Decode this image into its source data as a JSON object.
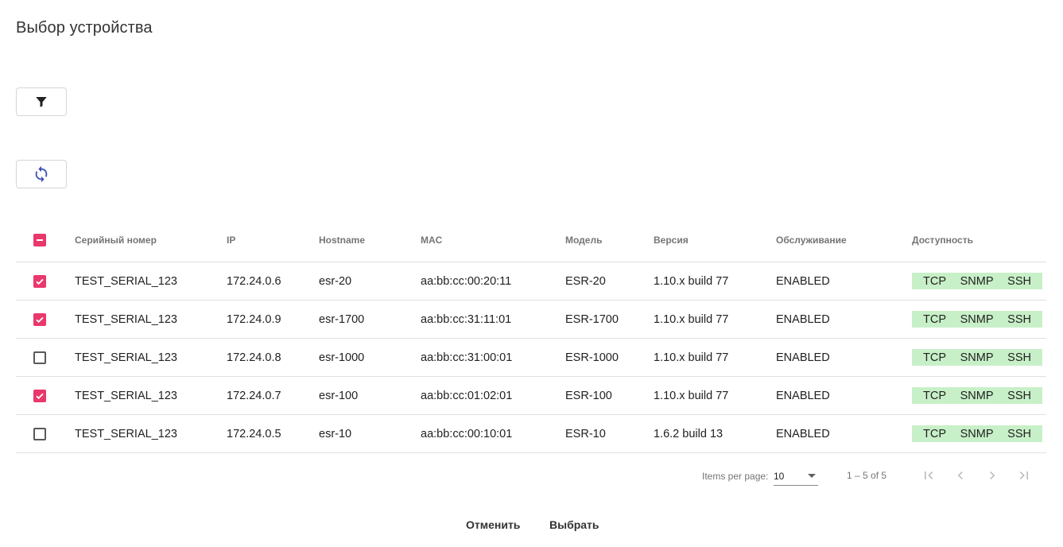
{
  "dialog": {
    "title": "Выбор устройства",
    "cancel_label": "Отменить",
    "select_label": "Выбрать"
  },
  "toolbar": {
    "filter_icon": "filter-icon",
    "refresh_icon": "refresh-icon"
  },
  "table": {
    "headers": {
      "serial": "Серийный номер",
      "ip": "IP",
      "hostname": "Hostname",
      "mac": "MAC",
      "model": "Модель",
      "version": "Версия",
      "service": "Обслуживание",
      "availability": "Доступность"
    },
    "header_checkbox_state": "indeterminate",
    "rows": [
      {
        "checked": true,
        "serial": "TEST_SERIAL_123",
        "ip": "172.24.0.6",
        "hostname": "esr-20",
        "mac": "aa:bb:cc:00:20:11",
        "model": "ESR-20",
        "version": "1.10.x build 77",
        "service": "ENABLED",
        "availability": [
          "TCP",
          "SNMP",
          "SSH"
        ]
      },
      {
        "checked": true,
        "serial": "TEST_SERIAL_123",
        "ip": "172.24.0.9",
        "hostname": "esr-1700",
        "mac": "aa:bb:cc:31:11:01",
        "model": "ESR-1700",
        "version": "1.10.x build 77",
        "service": "ENABLED",
        "availability": [
          "TCP",
          "SNMP",
          "SSH"
        ]
      },
      {
        "checked": false,
        "serial": "TEST_SERIAL_123",
        "ip": "172.24.0.8",
        "hostname": "esr-1000",
        "mac": "aa:bb:cc:31:00:01",
        "model": "ESR-1000",
        "version": "1.10.x build 77",
        "service": "ENABLED",
        "availability": [
          "TCP",
          "SNMP",
          "SSH"
        ]
      },
      {
        "checked": true,
        "serial": "TEST_SERIAL_123",
        "ip": "172.24.0.7",
        "hostname": "esr-100",
        "mac": "aa:bb:cc:01:02:01",
        "model": "ESR-100",
        "version": "1.10.x build 77",
        "service": "ENABLED",
        "availability": [
          "TCP",
          "SNMP",
          "SSH"
        ]
      },
      {
        "checked": false,
        "serial": "TEST_SERIAL_123",
        "ip": "172.24.0.5",
        "hostname": "esr-10",
        "mac": "aa:bb:cc:00:10:01",
        "model": "ESR-10",
        "version": "1.6.2 build 13",
        "service": "ENABLED",
        "availability": [
          "TCP",
          "SNMP",
          "SSH"
        ]
      }
    ]
  },
  "paginator": {
    "items_per_page_label": "Items per page:",
    "page_size": "10",
    "range_label": "1 – 5 of 5"
  },
  "colors": {
    "accent": "#e9386c",
    "availability_bg": "#c8f0c8",
    "refresh_icon": "#3f51b5"
  }
}
